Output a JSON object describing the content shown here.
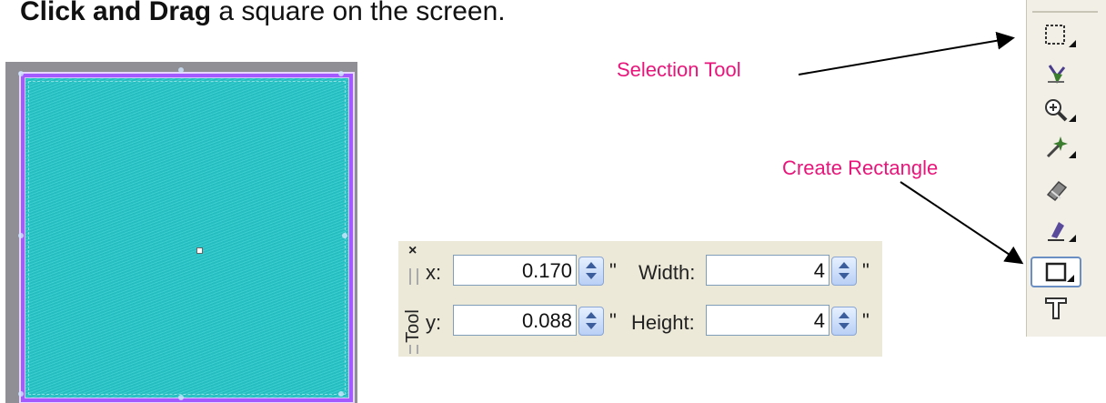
{
  "instruction": {
    "bold": "Click and Drag",
    "rest": " a square on the screen."
  },
  "tool_panel": {
    "title": "Tool",
    "close_glyph": "×",
    "x_label": "x:",
    "x_value": "0.170",
    "y_label": "y:",
    "y_value": "0.088",
    "width_label": "Width:",
    "width_value": "4",
    "height_label": "Height:",
    "height_value": "4",
    "unit": "\""
  },
  "annotations": {
    "selection_tool": "Selection Tool",
    "create_rectangle": "Create Rectangle"
  },
  "toolbar": {
    "tools": [
      {
        "name": "selection-tool-icon",
        "active": false
      },
      {
        "name": "reshape-tool-icon",
        "active": false
      },
      {
        "name": "zoom-tool-icon",
        "active": false
      },
      {
        "name": "magic-wand-tool-icon",
        "active": false
      },
      {
        "name": "eraser-tool-icon",
        "active": false
      },
      {
        "name": "digitize-tool-icon",
        "active": false
      },
      {
        "name": "create-rectangle-tool-icon",
        "active": true
      },
      {
        "name": "text-tool-icon",
        "active": false
      }
    ]
  },
  "colors": {
    "square_fill": "#27c9cc",
    "square_border": "#a35bff",
    "annotation": "#e8157a"
  }
}
